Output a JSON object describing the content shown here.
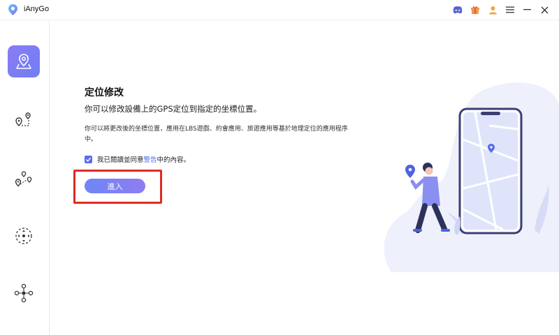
{
  "app": {
    "title": "iAnyGo"
  },
  "titlebar_icons": [
    "discord-icon",
    "gift-icon",
    "user-icon",
    "menu-icon",
    "minimize-icon",
    "close-icon"
  ],
  "sidebar": {
    "items": [
      {
        "name": "change-location",
        "active": true
      },
      {
        "name": "single-spot-movement",
        "active": false
      },
      {
        "name": "multi-spot-movement",
        "active": false
      },
      {
        "name": "joystick-movement",
        "active": false
      },
      {
        "name": "more-tools",
        "active": false
      }
    ]
  },
  "main": {
    "title": "定位修改",
    "subtitle": "你可以修改設備上的GPS定位到指定的坐標位置。",
    "description": "你可以將更改後的坐標位置，應用在LBS遊戲、約會應用、旅遊應用等基於地理定位的應用程序中。",
    "agreement": {
      "checked": true,
      "prefix": "我已閱讀並同意",
      "link": "警告",
      "suffix": "中的內容。"
    },
    "enter_button": "進入"
  },
  "colors": {
    "accent": "#6f7ef2",
    "link": "#3f6df0",
    "highlight": "#e02a25"
  }
}
